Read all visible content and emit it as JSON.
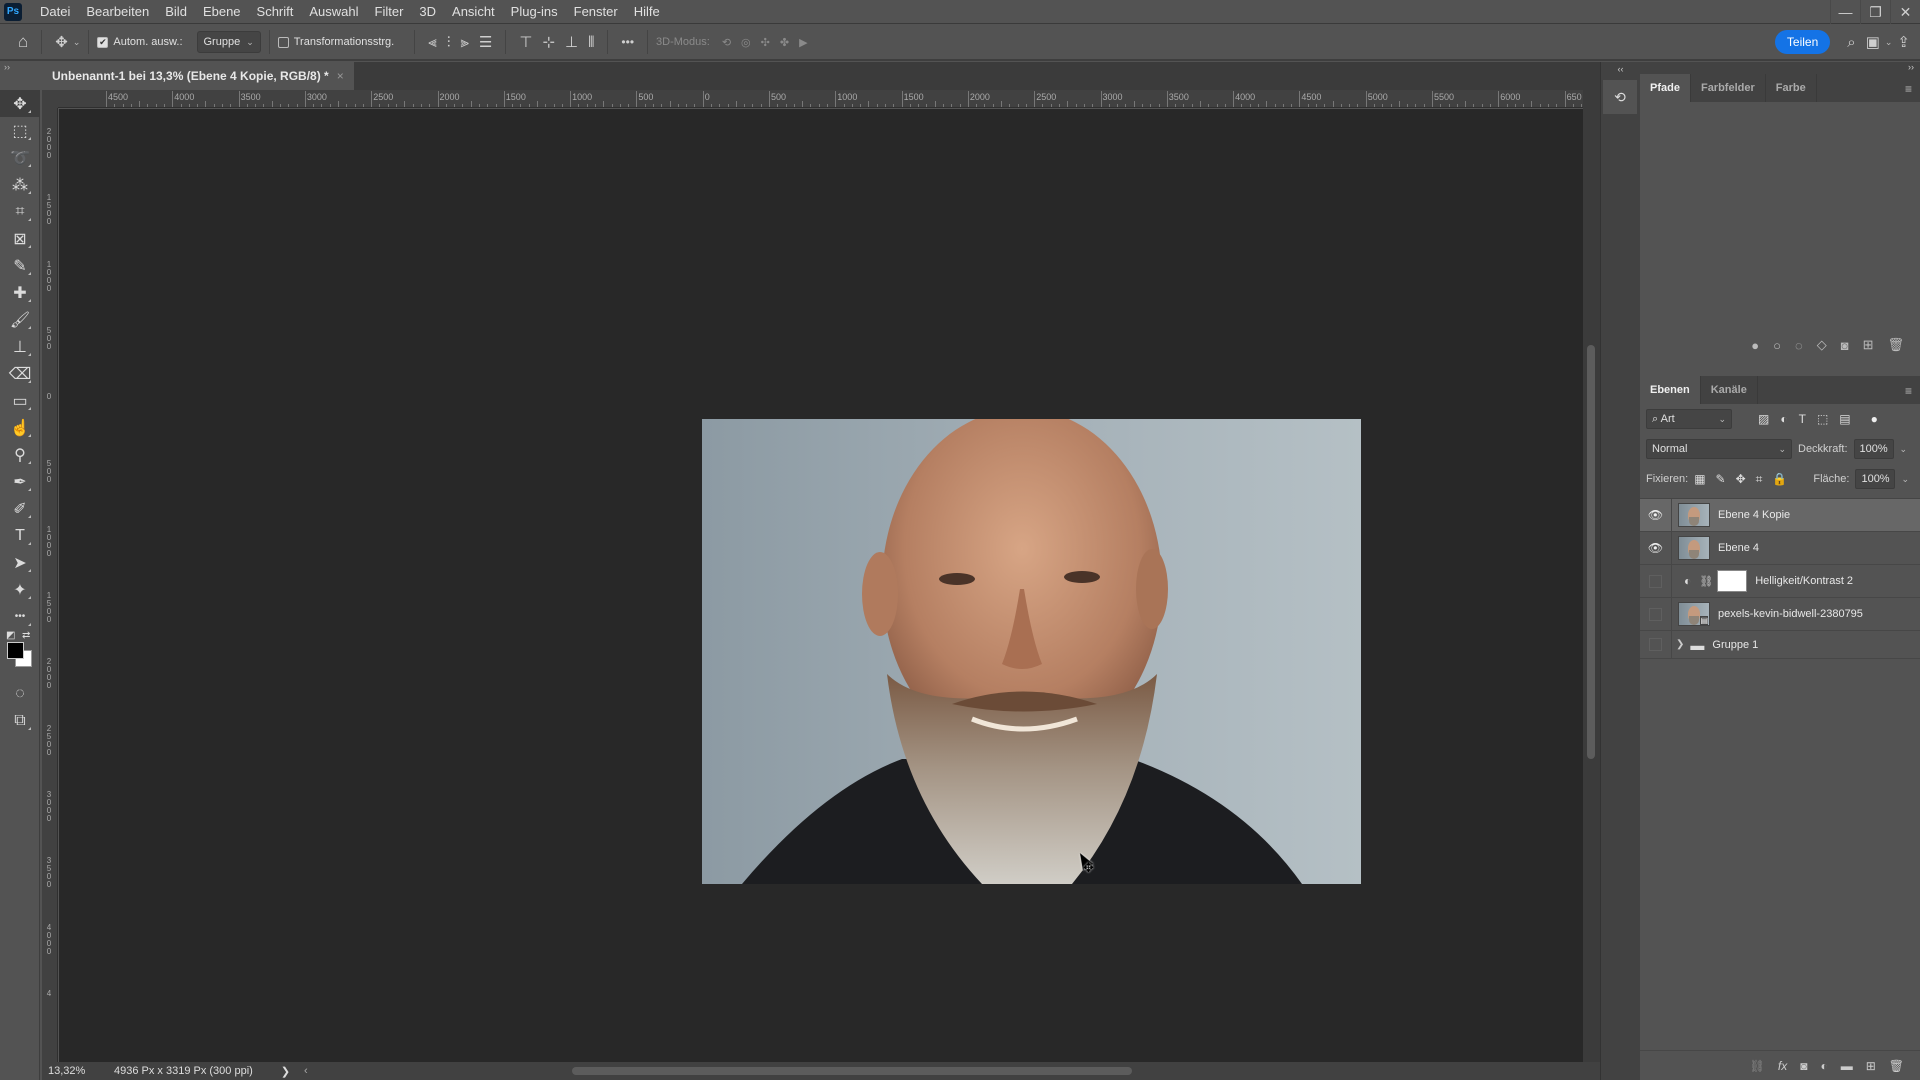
{
  "app": {
    "logo": "Ps"
  },
  "menu": [
    "Datei",
    "Bearbeiten",
    "Bild",
    "Ebene",
    "Schrift",
    "Auswahl",
    "Filter",
    "3D",
    "Ansicht",
    "Plug-ins",
    "Fenster",
    "Hilfe"
  ],
  "window_controls": {
    "minimize": "—",
    "restore": "❐",
    "close": "✕"
  },
  "options": {
    "auto_select_label": "Autom. ausw.:",
    "auto_select_checked": true,
    "auto_select_target": "Gruppe",
    "transform_label": "Transformationsstrg.",
    "transform_checked": false,
    "more": "•••",
    "mode_3d_label": "3D-Modus:",
    "share_label": "Teilen"
  },
  "document": {
    "tab_title": "Unbenannt-1 bei 13,3% (Ebene 4 Kopie, RGB/8) *",
    "close": "×",
    "zoom": "13,32%",
    "info": "4936 Px x 3319 Px (300 ppi)",
    "status_arrow": "❯",
    "scroll_left": "‹"
  },
  "rulers": {
    "horizontal": [
      "4500",
      "4000",
      "3500",
      "3000",
      "2500",
      "2000",
      "1500",
      "1000",
      "500",
      "0",
      "500",
      "1000",
      "1500",
      "2000",
      "2500",
      "3000",
      "3500",
      "4000",
      "4500",
      "5000",
      "5500",
      "6000",
      "650"
    ],
    "vertical": [
      "2000",
      "1500",
      "1000",
      "500",
      "0",
      "500",
      "1000",
      "1500",
      "2000",
      "2500",
      "3000",
      "3500",
      "4000",
      "4"
    ]
  },
  "tools": [
    {
      "name": "move-tool",
      "glyph": "✥"
    },
    {
      "name": "marquee-tool",
      "glyph": "⬚"
    },
    {
      "name": "lasso-tool",
      "glyph": "➰"
    },
    {
      "name": "magic-wand-tool",
      "glyph": "⁂"
    },
    {
      "name": "crop-tool",
      "glyph": "⌗"
    },
    {
      "name": "frame-tool",
      "glyph": "⊠"
    },
    {
      "name": "eyedropper-tool",
      "glyph": "✎"
    },
    {
      "name": "healing-brush-tool",
      "glyph": "✚"
    },
    {
      "name": "brush-tool",
      "glyph": "🖌"
    },
    {
      "name": "clone-stamp-tool",
      "glyph": "⊥"
    },
    {
      "name": "eraser-tool",
      "glyph": "⌫"
    },
    {
      "name": "gradient-tool",
      "glyph": "▭"
    },
    {
      "name": "smudge-tool",
      "glyph": "☝"
    },
    {
      "name": "dodge-tool",
      "glyph": "⚲"
    },
    {
      "name": "pen-tool",
      "glyph": "✒"
    },
    {
      "name": "freeform-pen-tool",
      "glyph": "✐"
    },
    {
      "name": "type-tool",
      "glyph": "T"
    },
    {
      "name": "path-selection-tool",
      "glyph": "➤"
    },
    {
      "name": "custom-shape-tool",
      "glyph": "✦"
    },
    {
      "name": "more-tools",
      "glyph": "•••"
    }
  ],
  "panels": {
    "top_tabs": [
      "Pfade",
      "Farbfelder",
      "Farbe"
    ],
    "layers_tabs": [
      "Ebenen",
      "Kanäle"
    ],
    "filter_kind": "Art",
    "blend_mode": "Normal",
    "opacity_label": "Deckkraft:",
    "opacity": "100%",
    "lock_label": "Fixieren:",
    "fill_label": "Fläche:",
    "fill": "100%",
    "layers": [
      {
        "name": "Ebene 4 Kopie",
        "visible": true,
        "selected": true,
        "type": "pixel"
      },
      {
        "name": "Ebene 4",
        "visible": true,
        "selected": false,
        "type": "pixel"
      },
      {
        "name": "Helligkeit/Kontrast 2",
        "visible": false,
        "selected": false,
        "type": "adjustment"
      },
      {
        "name": "pexels-kevin-bidwell-2380795",
        "visible": false,
        "selected": false,
        "type": "smart-object"
      },
      {
        "name": "Gruppe 1",
        "visible": false,
        "selected": false,
        "type": "group"
      }
    ]
  },
  "colors": {
    "accent": "#1473e6",
    "foreground": "#000000",
    "background": "#ffffff"
  }
}
